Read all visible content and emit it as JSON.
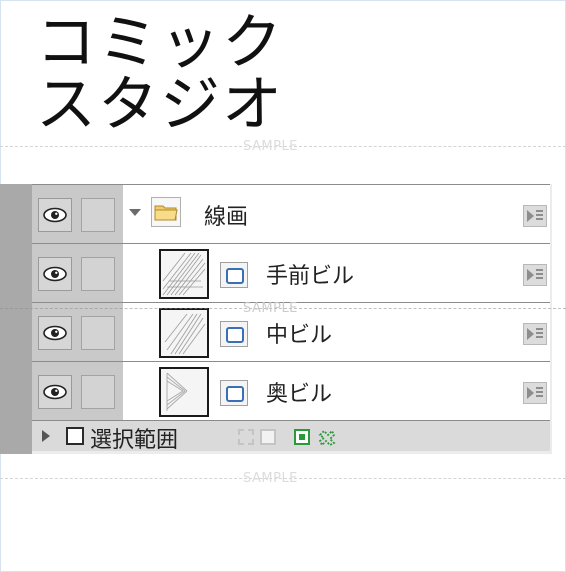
{
  "title": {
    "line1": "コミック",
    "line2": "スタジオ"
  },
  "watermark": "SAMPLE",
  "layers_panel": {
    "layers": [
      {
        "name": "線画",
        "kind": "folder",
        "visible": true,
        "expanded": true
      },
      {
        "name": "手前ビル",
        "kind": "raster",
        "visible": true
      },
      {
        "name": "中ビル",
        "kind": "raster",
        "visible": true
      },
      {
        "name": "奥ビル",
        "kind": "raster",
        "visible": true
      }
    ],
    "selection": {
      "label": "選択範囲"
    },
    "icons": {
      "eye": "eye-icon",
      "folder": "folder-icon",
      "raster": "raster-layer-icon",
      "properties": "layer-properties-icon"
    }
  },
  "colors": {
    "panel_background": "#c9c9c9",
    "raster_accent": "#3b6fb5",
    "selection_accent": "#2a9a3a"
  }
}
